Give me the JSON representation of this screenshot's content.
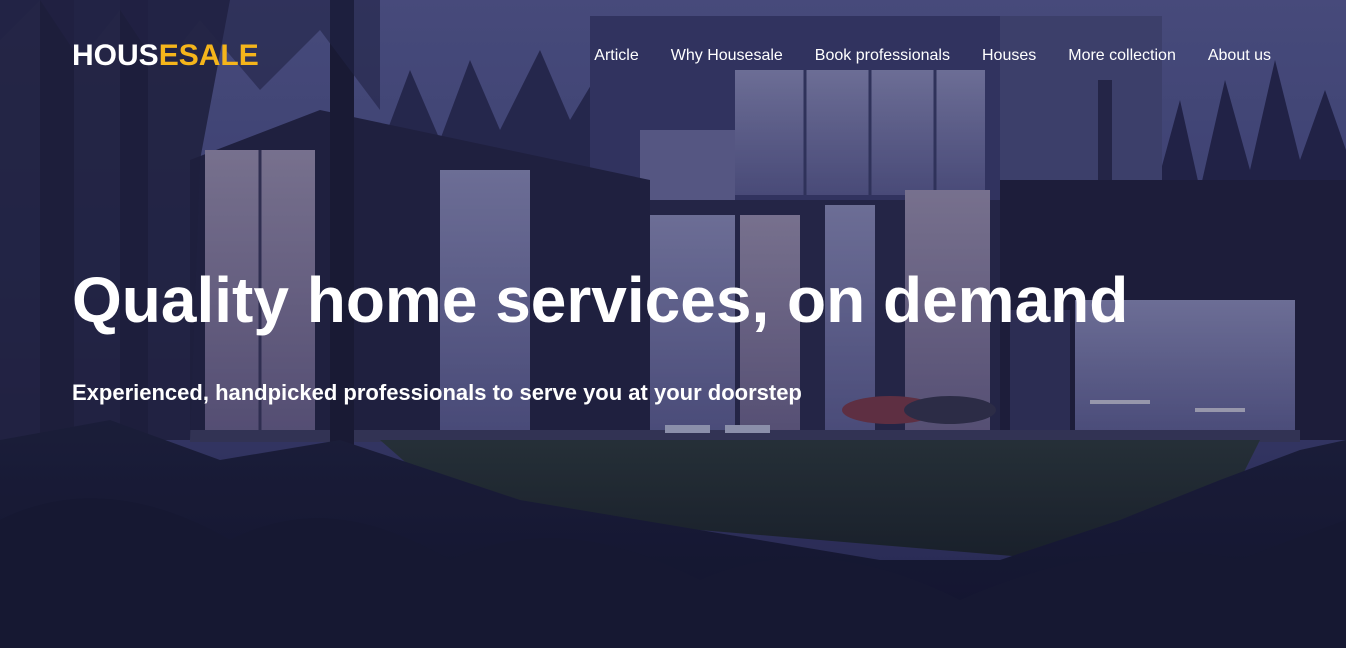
{
  "brand": {
    "logo_part1": "HOUS",
    "logo_part2": "ESALE",
    "logo_colors": {
      "part1": "#ffffff",
      "part2": "#f5b51b"
    }
  },
  "nav": {
    "items": [
      {
        "label": "Article"
      },
      {
        "label": "Why Housesale"
      },
      {
        "label": "Book professionals"
      },
      {
        "label": "Houses"
      },
      {
        "label": "More collection"
      },
      {
        "label": "About us"
      }
    ]
  },
  "hero": {
    "headline": "Quality home services, on demand",
    "subheadline": "Experienced, handpicked professionals to serve you at your doorstep",
    "background": "modern-house-at-dusk-photo"
  }
}
